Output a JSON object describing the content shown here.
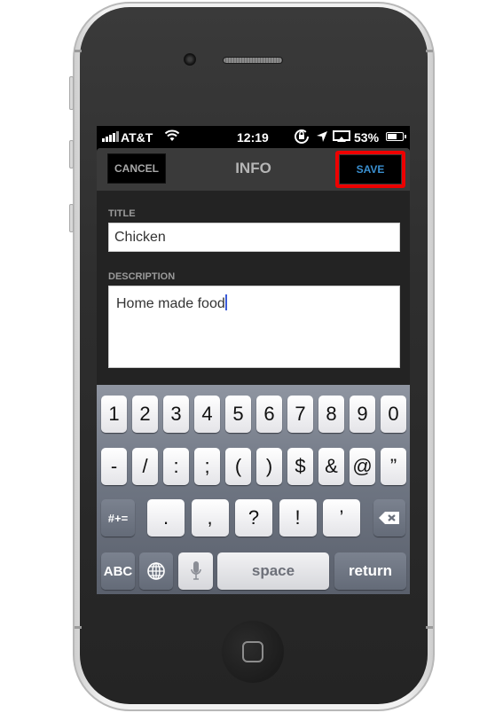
{
  "status_bar": {
    "carrier": "AT&T",
    "time": "12:19",
    "battery_percent_label": "53%",
    "battery_level": 0.53,
    "icons": [
      "signal-icon",
      "wifi-icon",
      "rotation-lock-icon",
      "location-icon",
      "airplay-icon",
      "battery-icon"
    ]
  },
  "navbar": {
    "title": "INFO",
    "cancel_label": "CANCEL",
    "save_label": "SAVE",
    "save_highlight_color": "#ee0000",
    "save_text_color": "#3a8fcf"
  },
  "form": {
    "title_label": "TITLE",
    "title_value": "Chicken",
    "description_label": "DESCRIPTION",
    "description_value": "Home made food"
  },
  "keyboard": {
    "row1": [
      "1",
      "2",
      "3",
      "4",
      "5",
      "6",
      "7",
      "8",
      "9",
      "0"
    ],
    "row2": [
      "-",
      "/",
      ":",
      ";",
      "(",
      ")",
      "$",
      "&",
      "@",
      "”"
    ],
    "row3_mode": "#+=",
    "row3": [
      ".",
      ",",
      "?",
      "!",
      "’"
    ],
    "delete_icon": "backspace-icon",
    "abc_label": "ABC",
    "globe_icon": "globe-icon",
    "mic_icon": "microphone-icon",
    "space_label": "space",
    "return_label": "return"
  }
}
